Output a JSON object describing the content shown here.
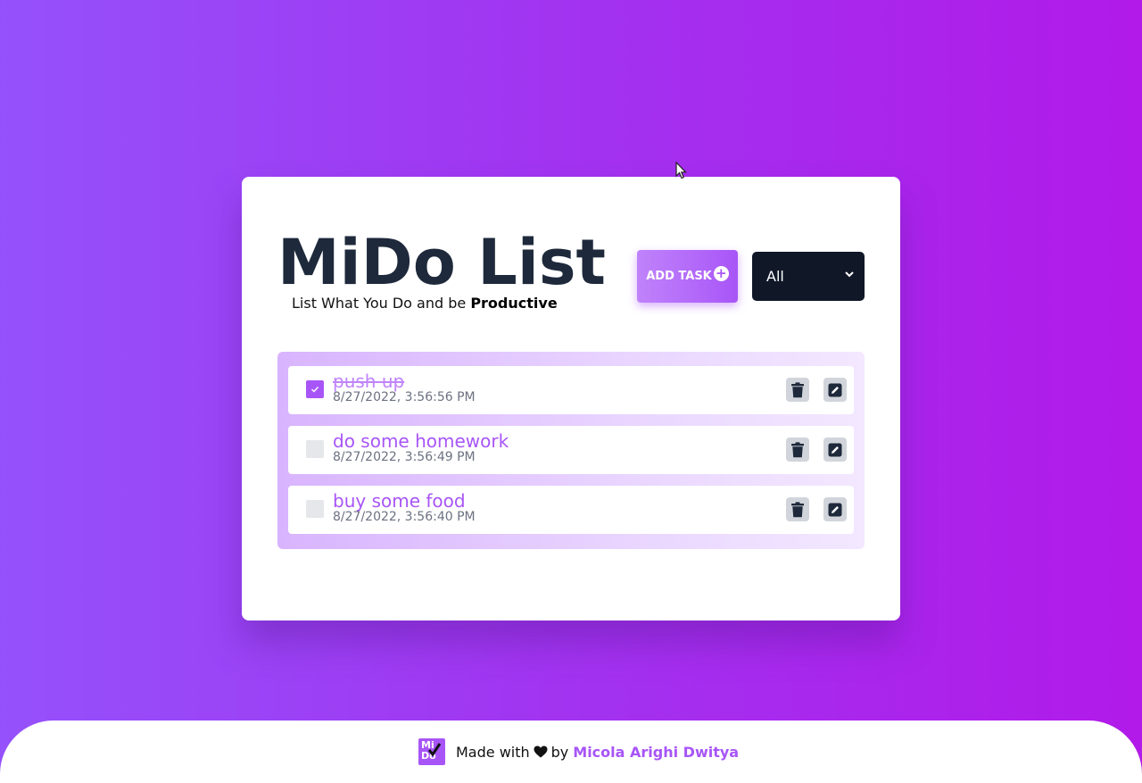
{
  "app": {
    "title": "MiDo List",
    "subtitle_prefix": "List What You Do and be ",
    "subtitle_bold": "Productive"
  },
  "toolbar": {
    "add_label": "ADD TASK",
    "add_icon": "plus-circle-icon",
    "filter_selected": "All"
  },
  "tasks": [
    {
      "title": "push up",
      "time": "8/27/2022, 3:56:56 PM",
      "completed": true
    },
    {
      "title": "do some homework",
      "time": "8/27/2022, 3:56:49 PM",
      "completed": false
    },
    {
      "title": "buy some food",
      "time": "8/27/2022, 3:56:40 PM",
      "completed": false
    }
  ],
  "footer": {
    "logo_text_top": "Mi",
    "logo_text_bottom": "Do",
    "made_with": "Made with",
    "by": "by",
    "author": "Micola Arighi Dwitya"
  },
  "colors": {
    "accent": "#a855f7",
    "dark": "#1e293b",
    "bg_start": "#9551fb",
    "bg_end": "#b11ae9"
  }
}
